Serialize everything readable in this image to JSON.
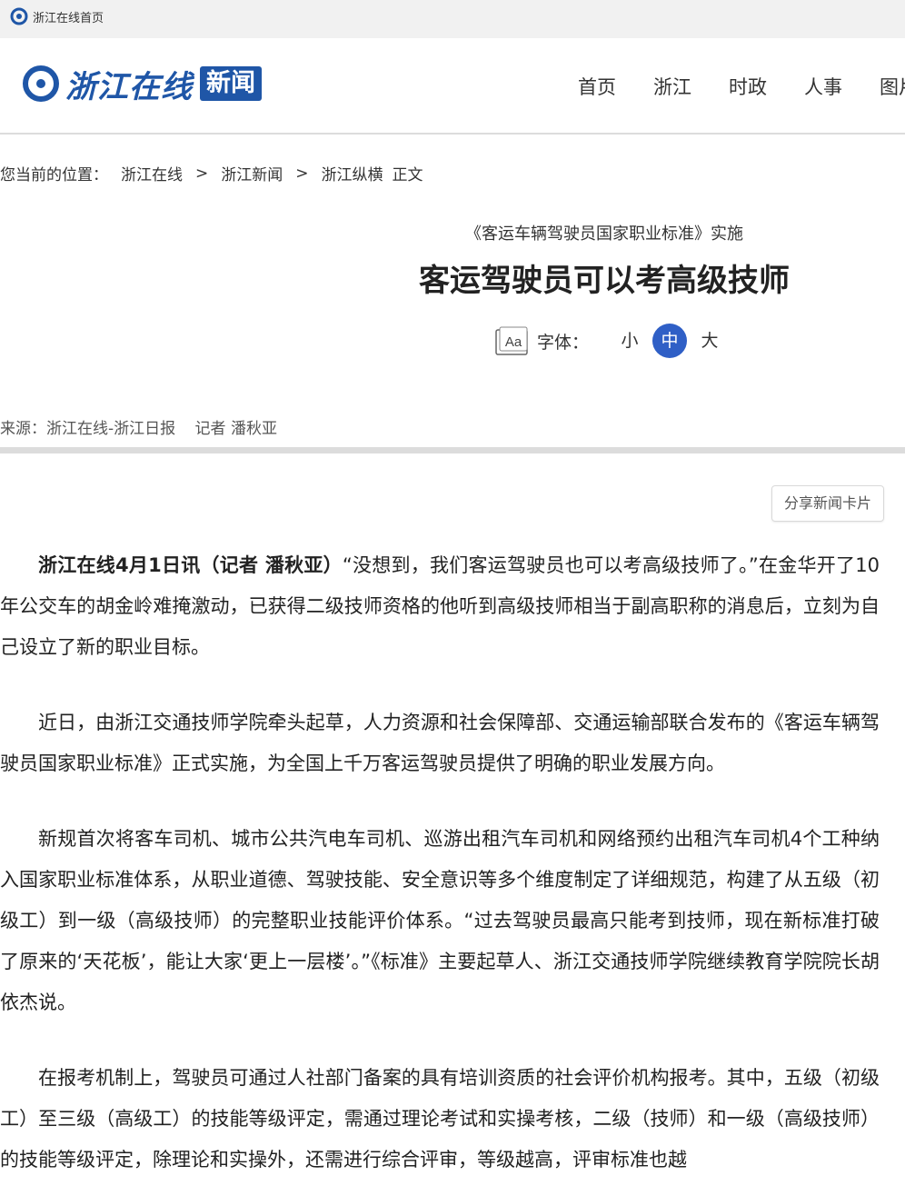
{
  "topbar": {
    "home_label": "浙江在线首页"
  },
  "header": {
    "logo_text": "浙江在线",
    "logo_badge": "新闻",
    "nav": [
      "首页",
      "浙江",
      "时政",
      "人事",
      "图片"
    ]
  },
  "breadcrumb": {
    "prefix": "您当前的位置：",
    "items": [
      "浙江在线",
      "浙江新闻",
      "浙江纵横"
    ],
    "separator": ">",
    "tail": "正文"
  },
  "article_header": {
    "subtitle": "《客运车辆驾驶员国家职业标准》实施",
    "title": "客运驾驶员可以考高级技师",
    "font_label": "字体：",
    "font_sizes": [
      "小",
      "中",
      "大"
    ],
    "font_size_selected": "中",
    "source": "来源：浙江在线-浙江日报",
    "reporter": "记者 潘秋亚"
  },
  "share": {
    "label": "分享新闻卡片"
  },
  "article": {
    "p1_lead": "浙江在线4月1日讯（记者 潘秋亚）",
    "p1_rest": "“没想到，我们客运驾驶员也可以考高级技师了。”在金华开了10年公交车的胡金岭难掩激动，已获得二级技师资格的他听到高级技师相当于副高职称的消息后，立刻为自己设立了新的职业目标。",
    "p2": "近日，由浙江交通技师学院牵头起草，人力资源和社会保障部、交通运输部联合发布的《客运车辆驾驶员国家职业标准》正式实施，为全国上千万客运驾驶员提供了明确的职业发展方向。",
    "p3": "新规首次将客车司机、城市公共汽电车司机、巡游出租汽车司机和网络预约出租汽车司机4个工种纳入国家职业标准体系，从职业道德、驾驶技能、安全意识等多个维度制定了详细规范，构建了从五级（初级工）到一级（高级技师）的完整职业技能评价体系。“过去驾驶员最高只能考到技师，现在新标准打破了原来的‘天花板’，能让大家‘更上一层楼’。”《标准》主要起草人、浙江交通技师学院继续教育学院院长胡依杰说。",
    "p4": "在报考机制上，驾驶员可通过人社部门备案的具有培训资质的社会评价机构报考。其中，五级（初级工）至三级（高级工）的技能等级评定，需通过理论考试和实操考核，二级（技师）和一级（高级技师）的技能等级评定，除理论和实操外，还需进行综合评审，等级越高，评审标准也越"
  },
  "colors": {
    "brand": "#1f56a7",
    "active": "#2f5fc6"
  }
}
